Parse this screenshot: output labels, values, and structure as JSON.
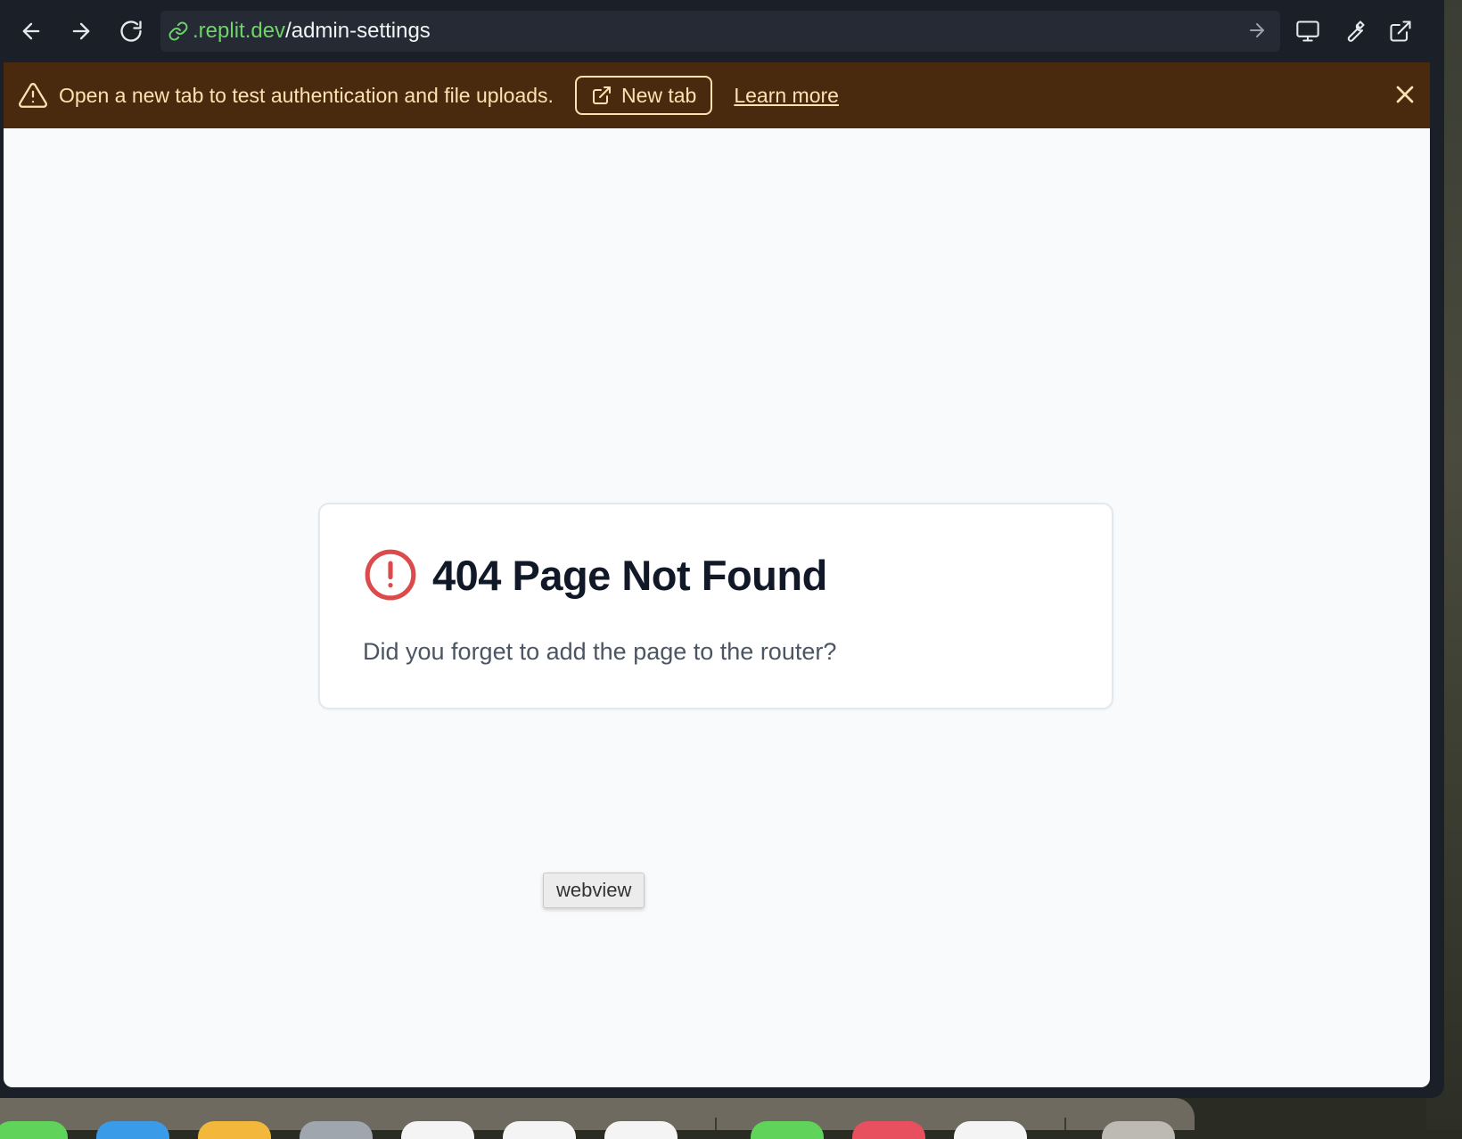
{
  "browser": {
    "url_domain": ".replit.dev",
    "url_path": "/admin-settings"
  },
  "banner": {
    "message": "Open a new tab to test authentication and file uploads.",
    "new_tab_label": "New tab",
    "learn_more_label": "Learn more"
  },
  "page": {
    "title": "404 Page Not Found",
    "description": "Did you forget to add the page to the router?"
  },
  "tooltip": {
    "text": "webview"
  },
  "colors": {
    "banner_bg": "#4a2a0f",
    "banner_fg": "#fde1b0",
    "error_icon": "#dc4b4b",
    "url_domain": "#6fd36a"
  },
  "dock": {
    "apps": [
      {
        "color": "#5fd35a"
      },
      {
        "color": "#3a9be8"
      },
      {
        "color": "#f3b73b"
      },
      {
        "color": "#9fa6ad"
      },
      {
        "color": "#f4f4f4"
      },
      {
        "color": "#f4f4f4"
      },
      {
        "color": "#f4f4f4"
      },
      {
        "color": "#5fd35a"
      },
      {
        "color": "#e9505f"
      },
      {
        "color": "#f4f4f4"
      },
      {
        "color": "#bdbab3"
      }
    ]
  }
}
